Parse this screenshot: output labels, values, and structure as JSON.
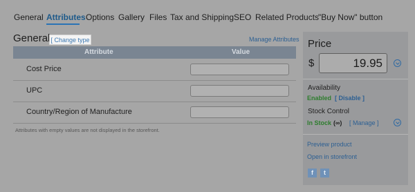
{
  "tabs": [
    {
      "label": "General"
    },
    {
      "label": "Attributes"
    },
    {
      "label": "Options"
    },
    {
      "label": "Gallery"
    },
    {
      "label": "Files"
    },
    {
      "label": "Tax and Shipping"
    },
    {
      "label": "SEO"
    },
    {
      "label": "Related Products"
    },
    {
      "label": "\"Buy Now\" button"
    }
  ],
  "active_tab": "Attributes",
  "section": {
    "title": "General",
    "change_type": "[ Change type ]",
    "manage_attributes": "Manage Attributes"
  },
  "table": {
    "columns": [
      "Attribute",
      "Value"
    ],
    "rows": [
      {
        "label": "Cost Price",
        "value": ""
      },
      {
        "label": "UPC",
        "value": ""
      },
      {
        "label": "Country/Region of Manufacture",
        "value": ""
      }
    ],
    "note": "Attributes with empty values are not displayed in the storefront."
  },
  "sidebar": {
    "price_title": "Price",
    "currency": "$",
    "price_value": "19.95",
    "availability_label": "Availability",
    "availability_status": "Enabled",
    "availability_action": "[ Disable ]",
    "stock_label": "Stock Control",
    "stock_status": "In Stock",
    "stock_qty": "(∞)",
    "stock_action": "[ Manage ]",
    "preview_link": "Preview product",
    "storefront_link": "Open in storefront",
    "social": [
      "f",
      "t"
    ]
  },
  "colors": {
    "accent": "#2a73b5",
    "link": "#2c5f92",
    "status_green": "#2e7d2e",
    "table_header": "#7a8592"
  }
}
